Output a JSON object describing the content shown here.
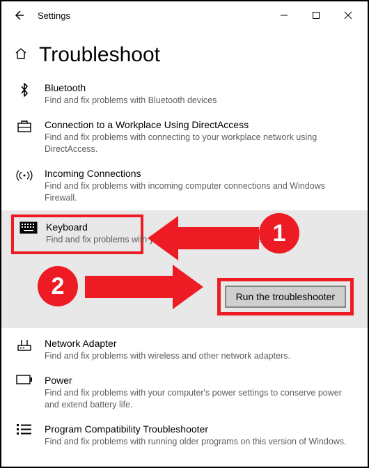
{
  "titlebar": {
    "title": "Settings"
  },
  "header": {
    "heading": "Troubleshoot"
  },
  "items": {
    "bluetooth": {
      "title": "Bluetooth",
      "desc": "Find and fix problems with Bluetooth devices"
    },
    "directaccess": {
      "title": "Connection to a Workplace Using DirectAccess",
      "desc": "Find and fix problems with connecting to your workplace network using DirectAccess."
    },
    "incoming": {
      "title": "Incoming Connections",
      "desc": "Find and fix problems with incoming computer connections and Windows Firewall."
    },
    "keyboard": {
      "title": "Keyboard",
      "desc": "Find and fix problems with your computer's keyboard settings.",
      "run_label": "Run the troubleshooter"
    },
    "network": {
      "title": "Network Adapter",
      "desc": "Find and fix problems with wireless and other network adapters."
    },
    "power": {
      "title": "Power",
      "desc": "Find and fix problems with your computer's power settings to conserve power and extend battery life."
    },
    "compat": {
      "title": "Program Compatibility Troubleshooter",
      "desc": "Find and fix problems with running older programs on this version of Windows."
    }
  },
  "annotations": {
    "step1": "1",
    "step2": "2"
  }
}
